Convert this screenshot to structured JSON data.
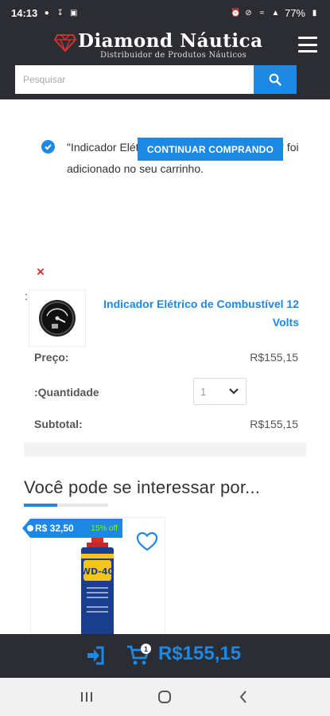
{
  "status_bar": {
    "time": "14:13",
    "battery": "77%"
  },
  "header": {
    "logo_title": "Diamond Náutica",
    "logo_subtitle": "Distribuidor de Produtos Náuticos",
    "search_placeholder": "Pesquisar"
  },
  "notice": {
    "message": "\"Indicador Elétrico de Combustível 12 Volts\" foi adicionado no seu carrinho.",
    "continue_label": "CONTINUAR COMPRANDO"
  },
  "cart_item": {
    "remove_symbol": "×",
    "colon": ":",
    "name": "Indicador Elétrico de Combustível 12 Volts",
    "price_label": "Preço:",
    "price_value": "R$155,15",
    "quantity_label": ":Quantidade",
    "quantity_value": "1",
    "subtotal_label": "Subtotal:",
    "subtotal_value": "R$155,15"
  },
  "related": {
    "title": "Você pode se interessar por...",
    "items": [
      {
        "price": "R$ 32,50",
        "discount": "15% off"
      }
    ]
  },
  "bottom_bar": {
    "cart_count": "1",
    "cart_total": "R$155,15"
  },
  "colors": {
    "header_bg": "#2b2d33",
    "accent": "#1e88e5",
    "remove": "#d32f2f"
  }
}
